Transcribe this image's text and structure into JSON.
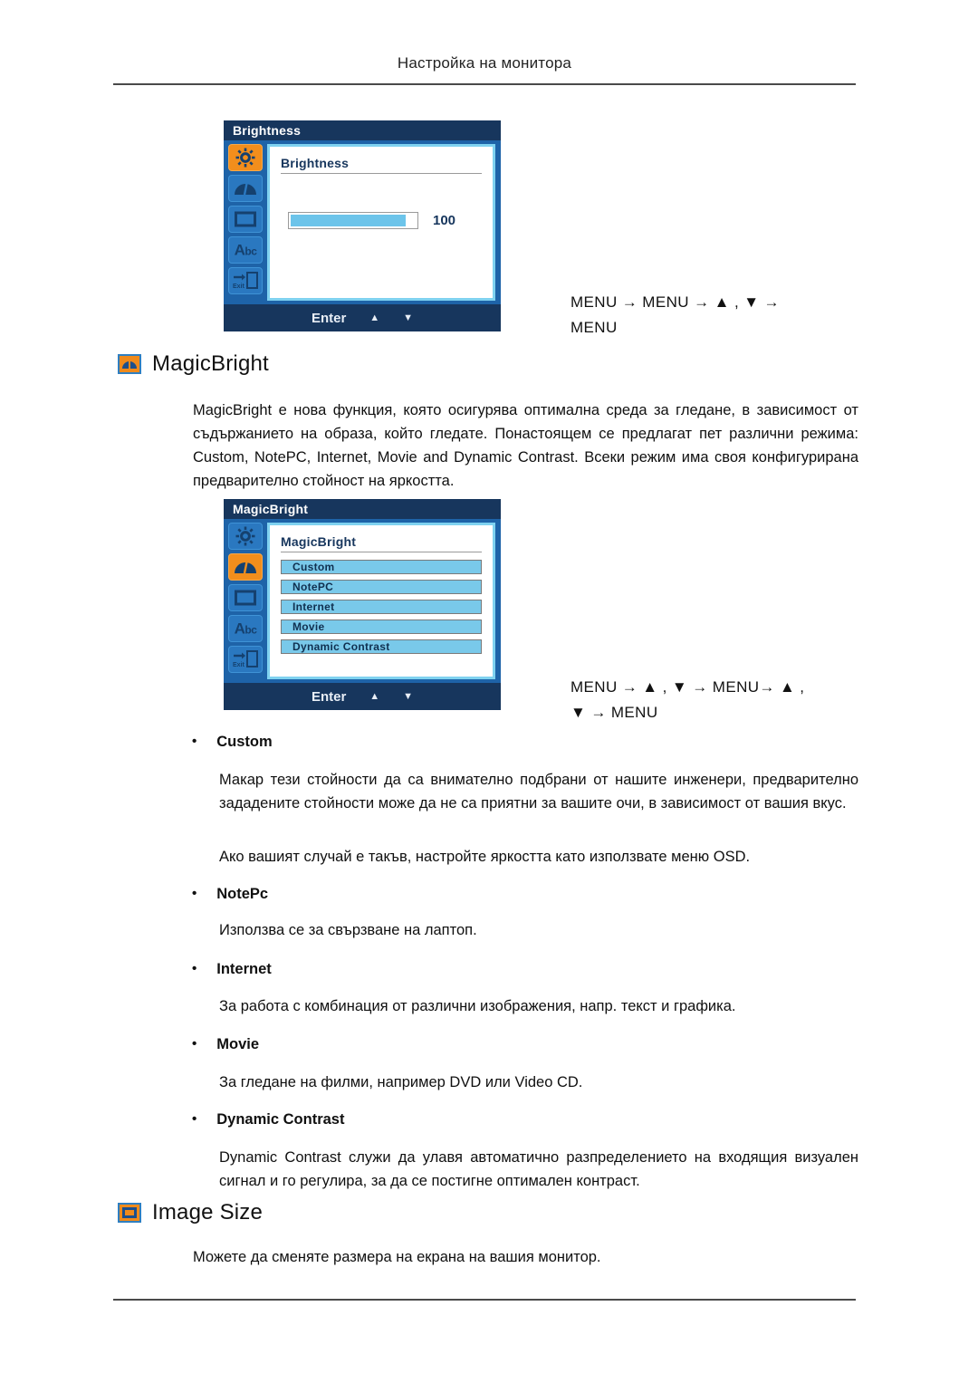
{
  "header": {
    "running_head": "Настройка на монитора"
  },
  "osd_brightness": {
    "title": "Brightness",
    "heading": "Brightness",
    "slider_value": "100",
    "slider_percent": 92,
    "rail_icons": [
      "sun-icon",
      "gauge-icon",
      "image-size-icon",
      "abc-icon",
      "exit-icon"
    ],
    "active_rail_index": 0,
    "footer": {
      "enter": "Enter",
      "up": "▲",
      "down": "▼"
    }
  },
  "keyseq_brightness": {
    "line1": "MENU → MENU → ▲ , ▼ →",
    "line2": "MENU"
  },
  "magicbright_section": {
    "heading": "MagicBright",
    "icon": "gauge-icon",
    "paragraph": "MagicBright е нова функция, която осигурява оптимална среда за гледане, в зависимост от съдържанието на образа, който гледате. Понастоящем се предлагат пет различни режима: Custom, NotePC, Internet, Movie and Dynamic Contrast. Всеки режим има своя конфигурирана предварително стойност на яркостта."
  },
  "osd_magicbright": {
    "title": "MagicBright",
    "heading": "MagicBright",
    "options": [
      "Custom",
      "NotePC",
      "Internet",
      "Movie",
      "Dynamic Contrast"
    ],
    "rail_icons": [
      "sun-icon",
      "gauge-icon",
      "image-size-icon",
      "abc-icon",
      "exit-icon"
    ],
    "active_rail_index": 1,
    "footer": {
      "enter": "Enter",
      "up": "▲",
      "down": "▼"
    }
  },
  "keyseq_magicbright": {
    "line1": "MENU → ▲ , ▼ → MENU→ ▲ ,",
    "line2": "▼ → MENU"
  },
  "modes": [
    {
      "bullet": "•",
      "title": "Custom",
      "body1": "Макар тези стойности да са внимателно подбрани от нашите инженери, предварително зададените стойности може да не са приятни за вашите очи, в зависимост от вашия вкус.",
      "body2": "Ако вашият случай е такъв, настройте яркостта като използвате меню OSD."
    },
    {
      "bullet": "•",
      "title": "NotePc",
      "body1": "Използва се за свързване на лаптоп.",
      "body2": ""
    },
    {
      "bullet": "•",
      "title": "Internet",
      "body1": "За работа с комбинация от различни изображения, напр. текст и графика.",
      "body2": ""
    },
    {
      "bullet": "•",
      "title": "Movie",
      "body1": "За гледане на филми, например DVD или Video CD.",
      "body2": ""
    },
    {
      "bullet": "•",
      "title": "Dynamic Contrast",
      "body1": "Dynamic Contrast служи да улавя автоматично разпределението на входящия визуален сигнал и го регулира, за да се постигне оптимален контраст.",
      "body2": ""
    }
  ],
  "imagesize_section": {
    "heading": "Image Size",
    "icon": "image-size-icon",
    "paragraph": "Можете да сменяте размера на екрана на вашия монитор."
  },
  "colors": {
    "accent_orange": "#f28e1c",
    "osd_navy": "#17365d",
    "osd_blue": "#1e63a8",
    "osd_light_blue": "#79c9ea",
    "slider_fill": "#6cc4ea"
  }
}
